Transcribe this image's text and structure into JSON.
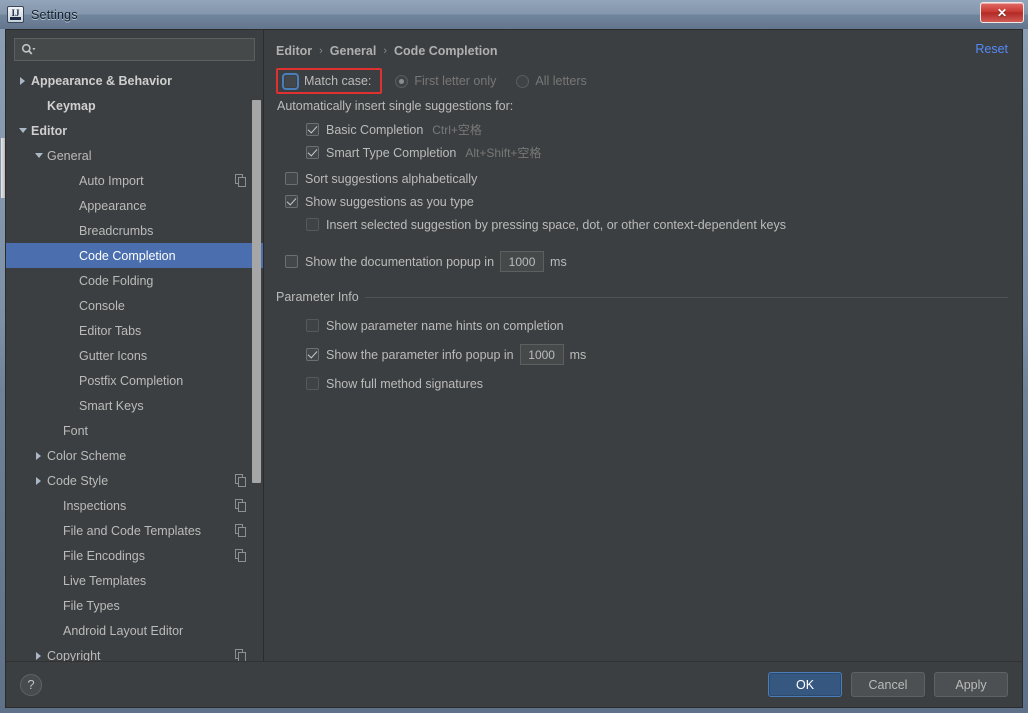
{
  "window": {
    "title": "Settings",
    "app_icon": "intellij-idea-icon",
    "close_label": "✕"
  },
  "search": {
    "value": "",
    "placeholder": "",
    "icon": "search-icon"
  },
  "sidebar": {
    "items": [
      {
        "label": "Appearance & Behavior",
        "indent": 0,
        "twisty": "collapsed",
        "bold": true,
        "selected": false,
        "copy_icon": false
      },
      {
        "label": "Keymap",
        "indent": 1,
        "twisty": "none",
        "bold": true,
        "selected": false,
        "copy_icon": false
      },
      {
        "label": "Editor",
        "indent": 0,
        "twisty": "expanded",
        "bold": true,
        "selected": false,
        "copy_icon": false
      },
      {
        "label": "General",
        "indent": 1,
        "twisty": "expanded",
        "bold": false,
        "selected": false,
        "copy_icon": false
      },
      {
        "label": "Auto Import",
        "indent": 3,
        "twisty": "none",
        "bold": false,
        "selected": false,
        "copy_icon": true
      },
      {
        "label": "Appearance",
        "indent": 3,
        "twisty": "none",
        "bold": false,
        "selected": false,
        "copy_icon": false
      },
      {
        "label": "Breadcrumbs",
        "indent": 3,
        "twisty": "none",
        "bold": false,
        "selected": false,
        "copy_icon": false
      },
      {
        "label": "Code Completion",
        "indent": 3,
        "twisty": "none",
        "bold": false,
        "selected": true,
        "copy_icon": false
      },
      {
        "label": "Code Folding",
        "indent": 3,
        "twisty": "none",
        "bold": false,
        "selected": false,
        "copy_icon": false
      },
      {
        "label": "Console",
        "indent": 3,
        "twisty": "none",
        "bold": false,
        "selected": false,
        "copy_icon": false
      },
      {
        "label": "Editor Tabs",
        "indent": 3,
        "twisty": "none",
        "bold": false,
        "selected": false,
        "copy_icon": false
      },
      {
        "label": "Gutter Icons",
        "indent": 3,
        "twisty": "none",
        "bold": false,
        "selected": false,
        "copy_icon": false
      },
      {
        "label": "Postfix Completion",
        "indent": 3,
        "twisty": "none",
        "bold": false,
        "selected": false,
        "copy_icon": false
      },
      {
        "label": "Smart Keys",
        "indent": 3,
        "twisty": "none",
        "bold": false,
        "selected": false,
        "copy_icon": false
      },
      {
        "label": "Font",
        "indent": 2,
        "twisty": "none",
        "bold": false,
        "selected": false,
        "copy_icon": false
      },
      {
        "label": "Color Scheme",
        "indent": 1,
        "twisty": "collapsed",
        "bold": false,
        "selected": false,
        "copy_icon": false
      },
      {
        "label": "Code Style",
        "indent": 1,
        "twisty": "collapsed",
        "bold": false,
        "selected": false,
        "copy_icon": true
      },
      {
        "label": "Inspections",
        "indent": 2,
        "twisty": "none",
        "bold": false,
        "selected": false,
        "copy_icon": true
      },
      {
        "label": "File and Code Templates",
        "indent": 2,
        "twisty": "none",
        "bold": false,
        "selected": false,
        "copy_icon": true
      },
      {
        "label": "File Encodings",
        "indent": 2,
        "twisty": "none",
        "bold": false,
        "selected": false,
        "copy_icon": true
      },
      {
        "label": "Live Templates",
        "indent": 2,
        "twisty": "none",
        "bold": false,
        "selected": false,
        "copy_icon": false
      },
      {
        "label": "File Types",
        "indent": 2,
        "twisty": "none",
        "bold": false,
        "selected": false,
        "copy_icon": false
      },
      {
        "label": "Android Layout Editor",
        "indent": 2,
        "twisty": "none",
        "bold": false,
        "selected": false,
        "copy_icon": false
      },
      {
        "label": "Copyright",
        "indent": 1,
        "twisty": "collapsed",
        "bold": false,
        "selected": false,
        "copy_icon": true
      }
    ]
  },
  "main": {
    "breadcrumb": [
      "Editor",
      "General",
      "Code Completion"
    ],
    "breadcrumb_separator": "›",
    "reset_label": "Reset",
    "match_case": {
      "label": "Match case:",
      "checked": false,
      "focused": true,
      "highlighted": true
    },
    "case_options": [
      {
        "label": "First letter only",
        "selected": true,
        "disabled": true
      },
      {
        "label": "All letters",
        "selected": false,
        "disabled": true
      }
    ],
    "auto_insert_label": "Automatically insert single suggestions for:",
    "auto_insert_items": [
      {
        "label": "Basic Completion",
        "checked": true,
        "shortcut": "Ctrl+空格"
      },
      {
        "label": "Smart Type Completion",
        "checked": true,
        "shortcut": "Alt+Shift+空格"
      }
    ],
    "sort_suggestions": {
      "label": "Sort suggestions alphabetically",
      "checked": false
    },
    "show_as_you_type": {
      "label": "Show suggestions as you type",
      "checked": true
    },
    "insert_selected": {
      "label": "Insert selected suggestion by pressing space, dot, or other context-dependent keys",
      "checked": false,
      "disabled": true
    },
    "doc_popup": {
      "label": "Show the documentation popup in",
      "checked": false,
      "value": "1000",
      "unit": "ms"
    },
    "parameter_info": {
      "legend": "Parameter Info",
      "name_hints": {
        "label": "Show parameter name hints on completion",
        "checked": false,
        "disabled": true
      },
      "info_popup": {
        "label": "Show the parameter info popup in",
        "checked": true,
        "value": "1000",
        "unit": "ms"
      },
      "full_signatures": {
        "label": "Show full method signatures",
        "checked": false,
        "disabled": true
      }
    }
  },
  "footer": {
    "help_label": "?",
    "buttons": [
      {
        "label": "OK",
        "primary": true
      },
      {
        "label": "Cancel",
        "primary": false
      },
      {
        "label": "Apply",
        "primary": false
      }
    ]
  },
  "colors": {
    "accent_selection": "#4b6eaf",
    "link": "#548af7",
    "panel_bg": "#3c3f41",
    "highlight_box": "#e03030",
    "primary_button": "#365880"
  }
}
